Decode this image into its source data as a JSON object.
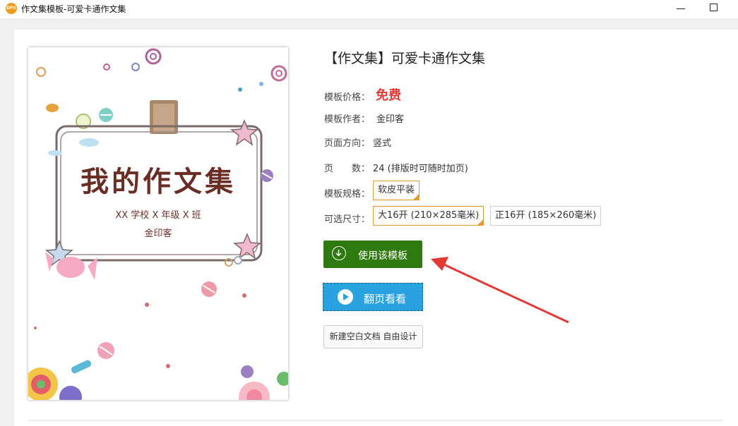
{
  "window": {
    "app_logo_text": "DPS",
    "title": "作文集模板-可爱卡通作文集"
  },
  "template": {
    "title": "【作文集】可爱卡通作文集",
    "price_label": "模板价格：",
    "price_value": "免费",
    "author_label": "模板作者：",
    "author_value": "金印客",
    "orientation_label": "页面方向：",
    "orientation_value": "竖式",
    "pages_label": "页　　数：",
    "pages_value": "24 (排版时可随时加页)",
    "spec_label": "模板规格：",
    "spec_options": [
      "软皮平装"
    ],
    "size_label": "可选尺寸：",
    "size_options": [
      "大16开 (210×285毫米)",
      "正16开 (185×260毫米)"
    ]
  },
  "buttons": {
    "use_template": "使用该模板",
    "flip_preview": "翻页看看",
    "new_blank": "新建空白文档 自由设计"
  },
  "cover": {
    "title": "我的作文集",
    "line1": "XX 学校 X 年级 X 班",
    "line2": "金印客"
  },
  "colors": {
    "use_button": "#2f7a10",
    "flip_button": "#29a3e0",
    "price": "#e53935",
    "selected_border": "#e59c2c",
    "annotation_arrow": "#e53935"
  }
}
